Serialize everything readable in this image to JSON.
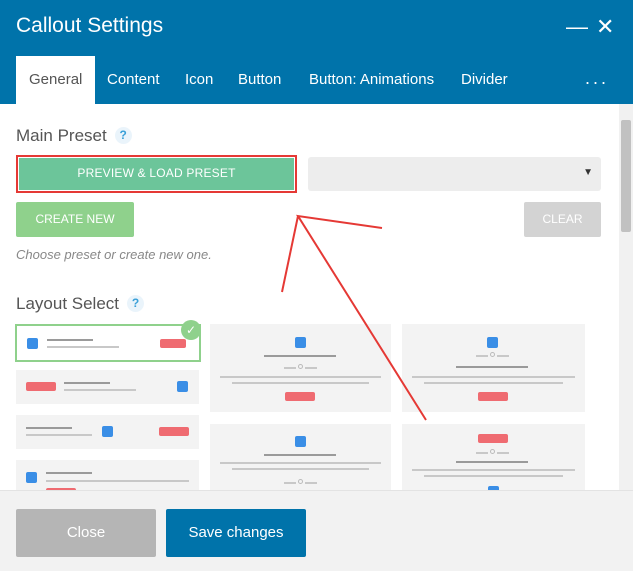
{
  "window": {
    "title": "Callout Settings",
    "minimize_glyph": "—",
    "close_glyph": "✕"
  },
  "tabs": [
    {
      "label": "General",
      "active": true
    },
    {
      "label": "Content"
    },
    {
      "label": "Icon"
    },
    {
      "label": "Button"
    },
    {
      "label": "Button: Animations"
    },
    {
      "label": "Divider"
    }
  ],
  "tabs_more": "...",
  "main_preset": {
    "title": "Main Preset",
    "help": "?",
    "preview_label": "PREVIEW & LOAD PRESET",
    "select_value": "",
    "select_arrow": "▼",
    "create_label": "CREATE NEW",
    "clear_label": "CLEAR",
    "hint": "Choose preset or create new one."
  },
  "layout_select": {
    "title": "Layout Select",
    "help": "?",
    "selected_check": "✓"
  },
  "footer": {
    "close_label": "Close",
    "save_label": "Save changes"
  },
  "colors": {
    "header_bg": "#0073aa",
    "preview_btn": "#6cc59a",
    "create_btn": "#8fd18c",
    "clear_btn": "#d3d3d3",
    "annotation": "#e53935"
  },
  "icons": [
    "minimize-icon",
    "close-icon",
    "more-icon",
    "help-icon",
    "chevron-down-icon",
    "check-icon"
  ]
}
